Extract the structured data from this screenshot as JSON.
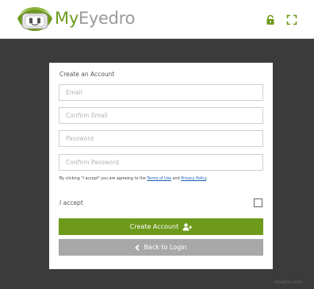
{
  "header": {
    "brand_prefix": "My",
    "brand_suffix": "Eyedro",
    "lock_icon": "lock-icon",
    "expand_icon": "expand-icon",
    "accent_color": "#6d9a1b"
  },
  "form": {
    "title": "Create an Account",
    "email_placeholder": "Email",
    "confirm_email_placeholder": "Confirm Email",
    "password_placeholder": "Password",
    "confirm_password_placeholder": "Confirm Password",
    "terms_prefix": "By clicking \"I accept\" you are agreeing to the ",
    "terms_link": "Terms of Use",
    "terms_and": " and ",
    "privacy_link": "Privacy Policy",
    "terms_suffix": ".",
    "accept_label": "I accept",
    "accept_checked": false,
    "create_button_label": "Create Account",
    "back_button_label": "Back to Login"
  },
  "footer": {
    "site": "eyedro.com"
  }
}
